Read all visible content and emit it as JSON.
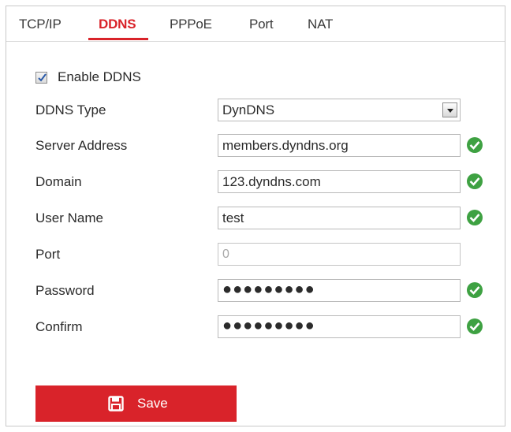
{
  "tabs": [
    {
      "label": "TCP/IP"
    },
    {
      "label": "DDNS"
    },
    {
      "label": "PPPoE"
    },
    {
      "label": "Port"
    },
    {
      "label": "NAT"
    }
  ],
  "active_tab": "DDNS",
  "enable": {
    "label": "Enable DDNS",
    "checked": true
  },
  "form": {
    "ddns_type": {
      "label": "DDNS Type",
      "value": "DynDNS"
    },
    "server_address": {
      "label": "Server Address",
      "value": "members.dyndns.org",
      "valid": true
    },
    "domain": {
      "label": "Domain",
      "value": "123.dyndns.com",
      "valid": true
    },
    "user_name": {
      "label": "User Name",
      "value": "test",
      "valid": true
    },
    "port": {
      "label": "Port",
      "value": "0",
      "disabled": true
    },
    "password": {
      "label": "Password",
      "value": "●●●●●●●●●",
      "valid": true
    },
    "confirm": {
      "label": "Confirm",
      "value": "●●●●●●●●●",
      "valid": true
    }
  },
  "save": {
    "label": "Save"
  },
  "colors": {
    "accent": "#d9232a",
    "ok": "#3ea142",
    "border": "#c9c9c9"
  },
  "icons": {
    "checkbox": "check-icon",
    "select": "chevron-down-icon",
    "valid": "check-circle-icon",
    "save": "floppy-disk-icon"
  }
}
